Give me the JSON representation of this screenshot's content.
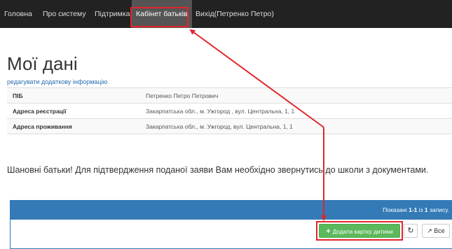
{
  "nav": {
    "items": [
      "Головна",
      "Про систему",
      "Підтримка",
      "Кабінет батьків",
      "Вихід(Петренко Петро)"
    ],
    "active_index": 3
  },
  "page": {
    "title": "Мої дані",
    "edit_link": "редагувати додаткову інформацію"
  },
  "info_table": {
    "rows": [
      {
        "label": "ПІБ",
        "value": "Петренко Петро Петрович"
      },
      {
        "label": "Адреса реєстрації",
        "value": "Закарпатська обл., м. Ужгород , вул. Центральна, 1, 1"
      },
      {
        "label": "Адреса проживання",
        "value": "Закарпатська обл., м. Ужгород, вул. Центральна, 1, 1"
      }
    ]
  },
  "notice": "Шановні батьки! Для підтвердження поданої заяви Вам необхідно звернутись до школи з документами.",
  "grid": {
    "summary_prefix": "Показані ",
    "summary_range": "1-1",
    "summary_mid": " із ",
    "summary_total": "1",
    "summary_suffix": " запису.",
    "add_button": "Додати картку дитини",
    "refresh_icon": "refresh-icon",
    "all_button": "Все"
  },
  "annotation": {
    "color": "#e2252b"
  }
}
